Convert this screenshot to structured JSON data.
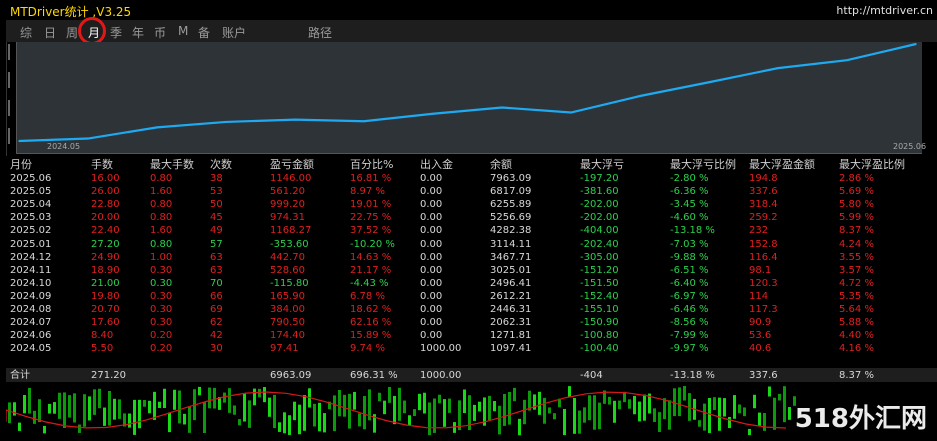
{
  "header": {
    "title": "MTDriver统计 ,V3.25",
    "url": "http://mtdriver.cn"
  },
  "tabs": [
    "综",
    "日",
    "周",
    "月",
    "季",
    "年",
    "币",
    "M",
    "备",
    "账户",
    "路径"
  ],
  "active_tab": "月",
  "chart": {
    "start_label": "2024.05",
    "end_label": "2025.06",
    "line_color": "#1eaaf1",
    "chart_data": {
      "type": "line",
      "x": [
        "2024.05",
        "2024.06",
        "2024.07",
        "2024.08",
        "2024.09",
        "2024.10",
        "2024.11",
        "2024.12",
        "2025.01",
        "2025.02",
        "2025.03",
        "2025.04",
        "2025.05",
        "2025.06"
      ],
      "values": [
        1097.41,
        1271.81,
        2062.31,
        2446.31,
        2612.21,
        2496.41,
        3025.01,
        3467.71,
        3114.11,
        4282.38,
        5256.69,
        6255.89,
        6817.09,
        7963.09
      ]
    }
  },
  "table": {
    "headers": [
      "月份",
      "手数",
      "最大手数",
      "次数",
      "盈亏金额",
      "百分比%",
      "出入金",
      "余额",
      "最大浮亏",
      "最大浮亏比例",
      "最大浮盈金额",
      "最大浮盈比例"
    ],
    "rows": [
      [
        "2025.06",
        "16.00",
        "0.80",
        "38",
        "1146.00",
        "16.81 %",
        "0.00",
        "7963.09",
        "-197.20",
        "-2.80 %",
        "194.8",
        "2.86 %"
      ],
      [
        "2025.05",
        "26.00",
        "1.60",
        "53",
        "561.20",
        "8.97 %",
        "0.00",
        "6817.09",
        "-381.60",
        "-6.36 %",
        "337.6",
        "5.69 %"
      ],
      [
        "2025.04",
        "22.80",
        "0.80",
        "50",
        "999.20",
        "19.01 %",
        "0.00",
        "6255.89",
        "-202.00",
        "-3.45 %",
        "318.4",
        "5.80 %"
      ],
      [
        "2025.03",
        "20.00",
        "0.80",
        "45",
        "974.31",
        "22.75 %",
        "0.00",
        "5256.69",
        "-202.00",
        "-4.60 %",
        "259.2",
        "5.99 %"
      ],
      [
        "2025.02",
        "22.40",
        "1.60",
        "49",
        "1168.27",
        "37.52 %",
        "0.00",
        "4282.38",
        "-404.00",
        "-13.18 %",
        "232",
        "8.37 %"
      ],
      [
        "2025.01",
        "27.20",
        "0.80",
        "57",
        "-353.60",
        "-10.20 %",
        "0.00",
        "3114.11",
        "-202.40",
        "-7.03 %",
        "152.8",
        "4.24 %"
      ],
      [
        "2024.12",
        "24.90",
        "1.00",
        "63",
        "442.70",
        "14.63 %",
        "0.00",
        "3467.71",
        "-305.00",
        "-9.88 %",
        "116.4",
        "3.55 %"
      ],
      [
        "2024.11",
        "18.90",
        "0.30",
        "63",
        "528.60",
        "21.17 %",
        "0.00",
        "3025.01",
        "-151.20",
        "-6.51 %",
        "98.1",
        "3.57 %"
      ],
      [
        "2024.10",
        "21.00",
        "0.30",
        "70",
        "-115.80",
        "-4.43 %",
        "0.00",
        "2496.41",
        "-151.50",
        "-6.40 %",
        "120.3",
        "4.72 %"
      ],
      [
        "2024.09",
        "19.80",
        "0.30",
        "66",
        "165.90",
        "6.78 %",
        "0.00",
        "2612.21",
        "-152.40",
        "-6.97 %",
        "114",
        "5.35 %"
      ],
      [
        "2024.08",
        "20.70",
        "0.30",
        "69",
        "384.00",
        "18.62 %",
        "0.00",
        "2446.31",
        "-155.10",
        "-6.46 %",
        "117.3",
        "5.64 %"
      ],
      [
        "2024.07",
        "17.60",
        "0.30",
        "62",
        "790.50",
        "62.16 %",
        "0.00",
        "2062.31",
        "-150.90",
        "-8.56 %",
        "90.9",
        "5.88 %"
      ],
      [
        "2024.06",
        "8.40",
        "0.20",
        "42",
        "174.40",
        "15.89 %",
        "0.00",
        "1271.81",
        "-100.80",
        "-7.99 %",
        "53.6",
        "4.40 %"
      ],
      [
        "2024.05",
        "5.50",
        "0.20",
        "30",
        "97.41",
        "9.74 %",
        "1000.00",
        "1097.41",
        "-100.40",
        "-9.97 %",
        "40.6",
        "4.16 %"
      ]
    ],
    "total": [
      "合计",
      "271.20",
      "",
      "",
      "6963.09",
      "696.31 %",
      "1000.00",
      "",
      "-404",
      "-13.18 %",
      "337.6",
      "8.37 %"
    ]
  },
  "watermark": "518外汇网"
}
